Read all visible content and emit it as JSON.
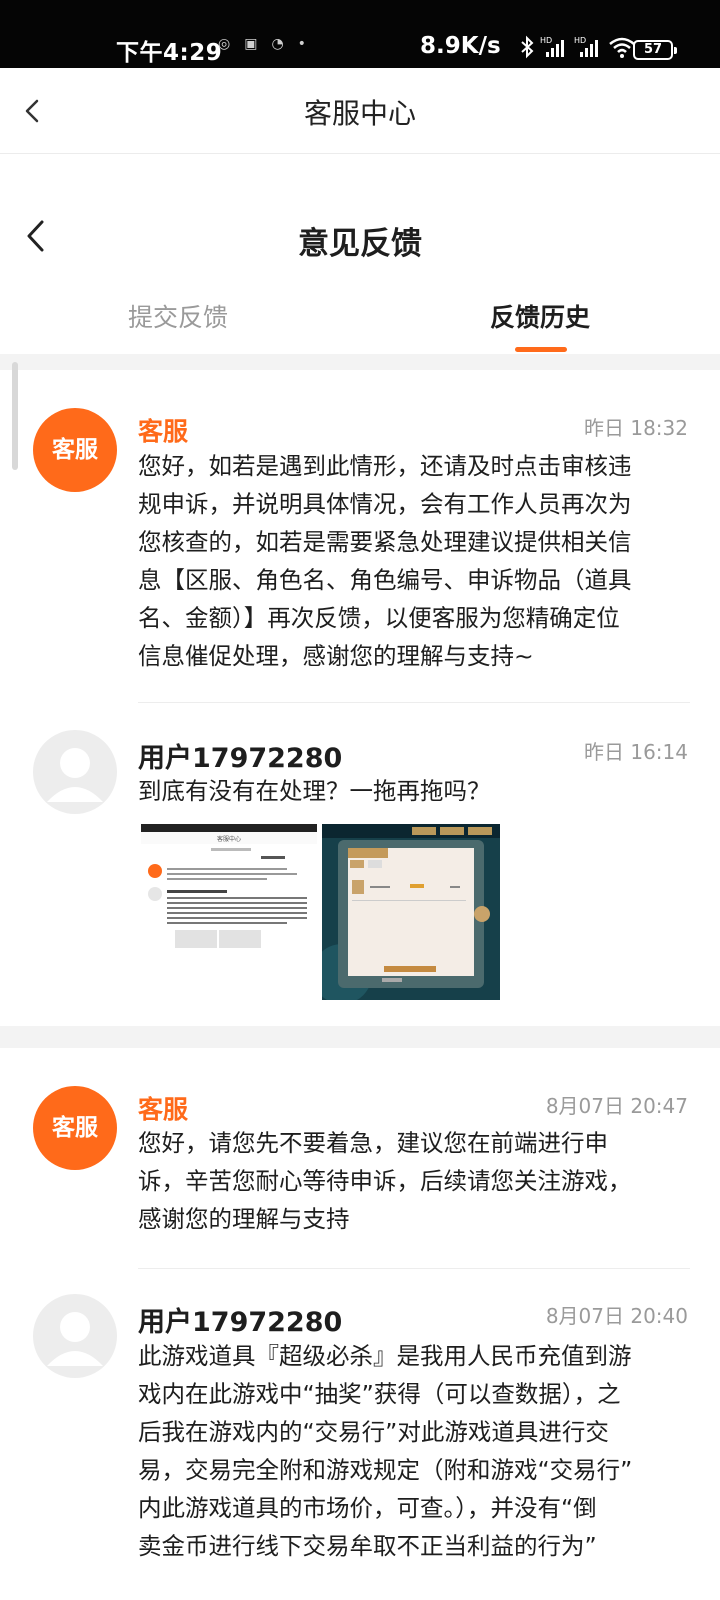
{
  "status_bar": {
    "time": "下午4:29",
    "net_speed": "8.9K/s",
    "battery": "57",
    "icons": [
      "notification-icon",
      "mail-icon",
      "app-icon",
      "bluetooth-icon",
      "signal-hd-icon",
      "signal-hd-icon",
      "wifi-icon",
      "battery-icon"
    ]
  },
  "outer_nav": {
    "title": "客服中心"
  },
  "inner_nav": {
    "title": "意见反馈"
  },
  "tabs": [
    {
      "label": "提交反馈",
      "active": false
    },
    {
      "label": "反馈历史",
      "active": true
    }
  ],
  "accent_color": "#ff6a1a",
  "messages": [
    {
      "sender": "客服",
      "avatar_text": "客服",
      "time": "昨日 18:32",
      "lines": [
        "您好，如若是遇到此情形，还请及时点击审核违",
        "规申诉，并说明具体情况，会有工作人员再次为",
        "您核查的，如若是需要紧急处理建议提供相关信",
        "息【区服、角色名、角色编号、申诉物品（道具",
        "名、金额）】再次反馈，以便客服为您精确定位",
        "信息催促处理，感谢您的理解与支持~"
      ]
    },
    {
      "sender": "用户17972280",
      "time": "昨日 16:14",
      "lines": [
        "到底有没有在处理？一拖再拖吗？"
      ],
      "attachments": [
        {
          "type": "screenshot",
          "caption": "客服中心"
        },
        {
          "type": "game-screenshot"
        }
      ]
    },
    {
      "sender": "客服",
      "avatar_text": "客服",
      "time": "8月07日 20:47",
      "lines": [
        "您好，请您先不要着急，建议您在前端进行申",
        "诉，辛苦您耐心等待申诉，后续请您关注游戏，",
        "感谢您的理解与支持"
      ]
    },
    {
      "sender": "用户17972280",
      "time": "8月07日 20:40",
      "lines": [
        "此游戏道具『超级必杀』是我用人民币充值到游",
        "戏内在此游戏中“抽奖”获得（可以查数据），之",
        "后我在游戏内的“交易行”对此游戏道具进行交",
        "易，交易完全附和游戏规定（附和游戏“交易行”",
        "内此游戏道具的市场价，可查。），并没有“倒",
        "卖金币进行线下交易牟取不正当利益的行为”"
      ]
    }
  ]
}
